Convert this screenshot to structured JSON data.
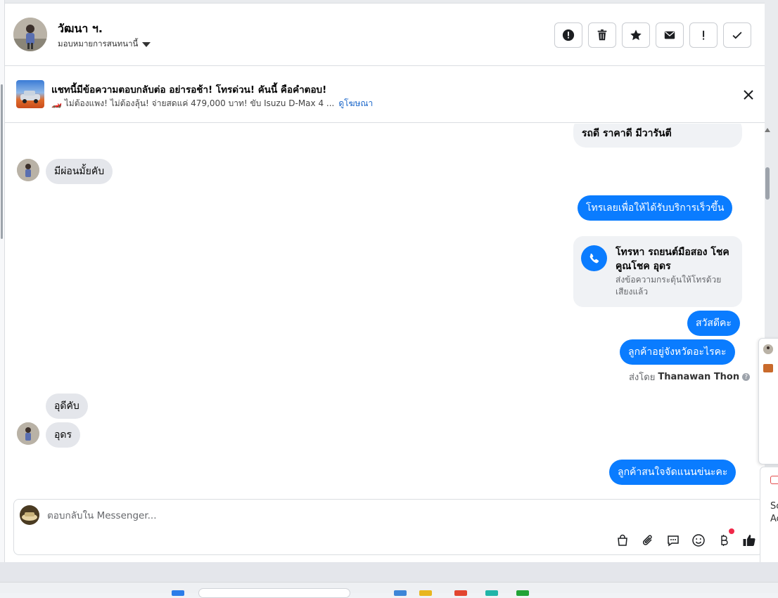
{
  "header": {
    "contact_name": "วัฒนา ฯ.",
    "assign_label": "มอบหมายการสนทนานี้",
    "actions": [
      {
        "name": "report-button",
        "icon": "alert-circle-icon"
      },
      {
        "name": "delete-button",
        "icon": "trash-icon"
      },
      {
        "name": "star-button",
        "icon": "star-icon"
      },
      {
        "name": "mark-unread-button",
        "icon": "envelope-icon"
      },
      {
        "name": "follow-up-button",
        "icon": "exclamation-icon"
      },
      {
        "name": "mark-done-button",
        "icon": "check-icon"
      }
    ]
  },
  "ad": {
    "title": "แชทนี้มีข้อความตอบกลับต่อ อย่ารอช้า! โทรด่วน! คันนี้ คือคำตอบ!",
    "subtitle": "🏎️ ไม่ต้องแพง! ไม่ต้องลุ้น! จ่ายสดแค่ 479,000 บาท! ขับ Isuzu D-Max 4 ...",
    "link": "ดูโฆษณา"
  },
  "messages": {
    "m1": "รถดี ราคาดี มีวารันตี",
    "m2": "มีผ่อนมั้ยคับ",
    "m3": "โทรเลยเพื่อให้ได้รับบริการเร็วขึ้น",
    "call_title": "โทรหา รถยนต์มือสอง โชคคูณโชค อุดร",
    "call_sub": "ส่งข้อความกระตุ้นให้โทรด้วยเสียงแล้ว",
    "m4": "สวัสดีคะ",
    "m5": "ลูกค้าอยู่จังหวัดอะไรคะ",
    "sent_by_prefix": "ส่งโดย",
    "sent_by_name": "Thanawan Thon",
    "m6": "อุดีคับ",
    "m7": "อุดร",
    "m8": "ลูกค้าสนใจจัดแนนข่นะคะ"
  },
  "composer": {
    "placeholder": "ตอบกลับใน Messenger...",
    "tools": [
      "shopping-bag-icon",
      "paperclip-icon",
      "saved-reply-icon",
      "emoji-icon",
      "baht-payment-icon",
      "thumbs-up-icon"
    ]
  },
  "popup": {
    "line1": "Sc",
    "line2": "Ac"
  },
  "colors": {
    "accent": "#0a7cff",
    "incoming_bubble": "#e4e6eb",
    "notification_dot": "#f02849"
  }
}
